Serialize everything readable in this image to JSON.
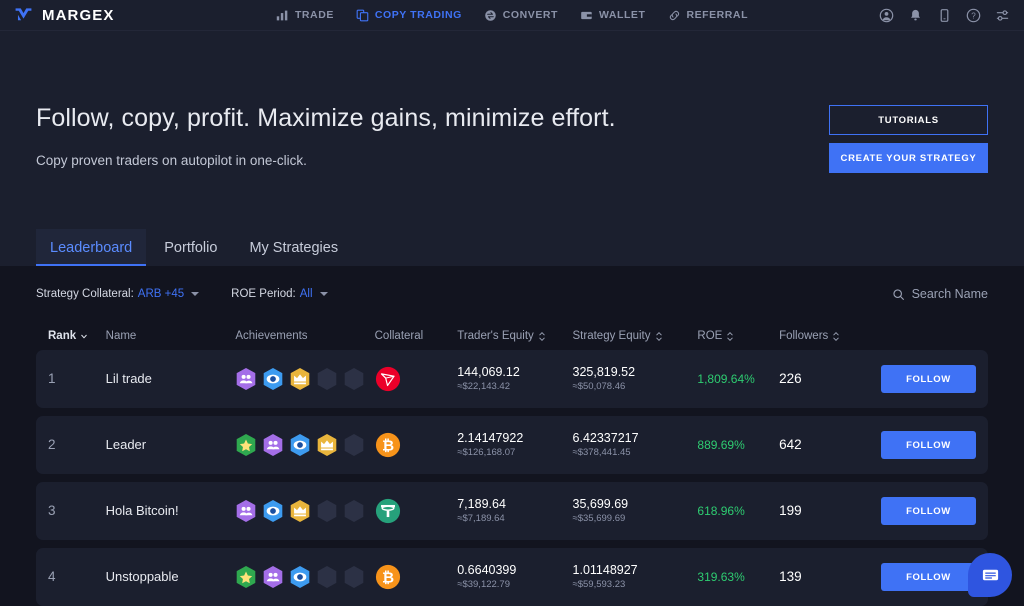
{
  "brand": {
    "name": "MARGEX",
    "logo_icon": "margex-logo-icon",
    "accent": "#3f72f5"
  },
  "topnav": {
    "items": [
      {
        "label": "TRADE",
        "icon": "bar-chart-icon",
        "active": false
      },
      {
        "label": "COPY TRADING",
        "icon": "copy-icon",
        "active": true
      },
      {
        "label": "CONVERT",
        "icon": "convert-circle-icon",
        "active": false
      },
      {
        "label": "WALLET",
        "icon": "wallet-icon",
        "active": false
      },
      {
        "label": "REFERRAL",
        "icon": "link-icon",
        "active": false
      }
    ],
    "right_icons": [
      {
        "name": "account-icon"
      },
      {
        "name": "bell-icon"
      },
      {
        "name": "mobile-app-icon"
      },
      {
        "name": "help-icon"
      },
      {
        "name": "settings-sliders-icon"
      }
    ]
  },
  "hero": {
    "title": "Follow, copy, profit. Maximize gains, minimize effort.",
    "subtitle": "Copy proven traders on autopilot in one-click.",
    "tutorials_label": "TUTORIALS",
    "create_strategy_label": "CREATE YOUR STRATEGY"
  },
  "tabs": [
    {
      "label": "Leaderboard",
      "active": true
    },
    {
      "label": "Portfolio",
      "active": false
    },
    {
      "label": "My Strategies",
      "active": false
    }
  ],
  "filters": {
    "collateral": {
      "label": "Strategy Collateral:",
      "value": "ARB +45"
    },
    "roe_period": {
      "label": "ROE Period:",
      "value": "All"
    }
  },
  "search": {
    "placeholder": "Search Name",
    "icon": "search-icon"
  },
  "table": {
    "headers": [
      {
        "label": "Rank",
        "sortable": true,
        "sort_icon": "chevron-down-icon"
      },
      {
        "label": "Name",
        "sortable": false
      },
      {
        "label": "Achievements",
        "sortable": false
      },
      {
        "label": "Collateral",
        "sortable": false
      },
      {
        "label": "Trader's Equity",
        "sortable": true,
        "sort_icon": "sort-updown-icon"
      },
      {
        "label": "Strategy Equity",
        "sortable": true,
        "sort_icon": "sort-updown-icon"
      },
      {
        "label": "ROE",
        "sortable": true,
        "sort_icon": "sort-updown-icon"
      },
      {
        "label": "Followers",
        "sortable": true,
        "sort_icon": "sort-updown-icon"
      }
    ],
    "follow_label": "FOLLOW",
    "rows": [
      {
        "rank": "1",
        "name": "Lil trade",
        "achievements": [
          "empty",
          "people",
          "eye",
          "crown",
          "empty",
          "empty"
        ],
        "collateral": {
          "symbol": "TRX",
          "icon": "tron-coin-icon",
          "color": "#eb0029"
        },
        "trader_equity": "144,069.12",
        "trader_equity_usd": "≈$22,143.42",
        "strategy_equity": "325,819.52",
        "strategy_equity_usd": "≈$50,078.46",
        "roe": "1,809.64%",
        "followers": "226"
      },
      {
        "rank": "2",
        "name": "Leader",
        "achievements": [
          "star",
          "people",
          "eye",
          "crown",
          "empty"
        ],
        "collateral": {
          "symbol": "BTC",
          "icon": "bitcoin-coin-icon",
          "color": "#f7931a"
        },
        "trader_equity": "2.14147922",
        "trader_equity_usd": "≈$126,168.07",
        "strategy_equity": "6.42337217",
        "strategy_equity_usd": "≈$378,441.45",
        "roe": "889.69%",
        "followers": "642"
      },
      {
        "rank": "3",
        "name": "Hola Bitcoin!",
        "achievements": [
          "empty",
          "people",
          "eye",
          "crown",
          "empty",
          "empty"
        ],
        "collateral": {
          "symbol": "USDT",
          "icon": "tether-coin-icon",
          "color": "#26a17b"
        },
        "trader_equity": "7,189.64",
        "trader_equity_usd": "≈$7,189.64",
        "strategy_equity": "35,699.69",
        "strategy_equity_usd": "≈$35,699.69",
        "roe": "618.96%",
        "followers": "199"
      },
      {
        "rank": "4",
        "name": "Unstoppable",
        "achievements": [
          "star",
          "people",
          "eye",
          "empty",
          "empty"
        ],
        "collateral": {
          "symbol": "BTC",
          "icon": "bitcoin-coin-icon",
          "color": "#f7931a"
        },
        "trader_equity": "0.6640399",
        "trader_equity_usd": "≈$39,122.79",
        "strategy_equity": "1.01148927",
        "strategy_equity_usd": "≈$59,593.23",
        "roe": "319.63%",
        "followers": "139"
      }
    ]
  },
  "chat": {
    "icon": "chat-bubble-icon"
  }
}
